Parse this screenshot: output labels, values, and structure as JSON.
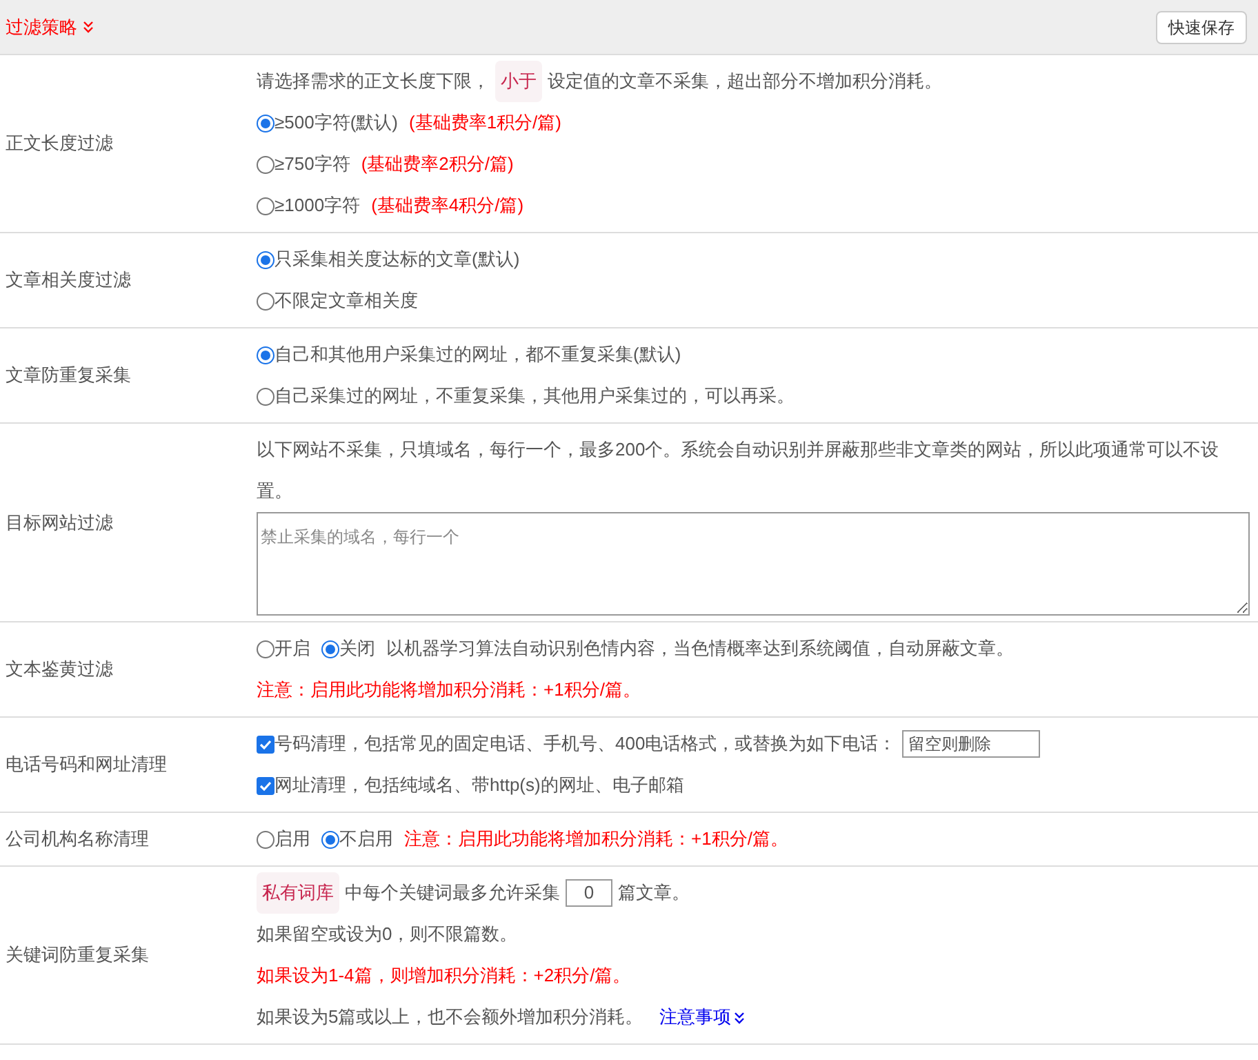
{
  "header": {
    "title": "过滤策略",
    "button": "快速保存"
  },
  "rows": [
    {
      "label": "正文长度过滤",
      "lines": [
        [
          {
            "kind": "text",
            "text": "请选择需求的正文长度下限，"
          },
          {
            "kind": "tag",
            "text": "小于"
          },
          {
            "kind": "text",
            "text": "设定值的文章不采集，超出部分不增加积分消耗。"
          }
        ],
        [
          {
            "kind": "radio",
            "text": "≥500字符(默认)",
            "selected": true
          },
          {
            "kind": "note",
            "text": "(基础费率1积分/篇)"
          }
        ],
        [
          {
            "kind": "radio",
            "text": "≥750字符",
            "selected": false
          },
          {
            "kind": "note",
            "text": "(基础费率2积分/篇)"
          }
        ],
        [
          {
            "kind": "radio",
            "text": "≥1000字符",
            "selected": false
          },
          {
            "kind": "note",
            "text": "(基础费率4积分/篇)"
          }
        ]
      ]
    },
    {
      "label": "文章相关度过滤",
      "lines": [
        [
          {
            "kind": "radio",
            "text": "只采集相关度达标的文章(默认)",
            "selected": true
          }
        ],
        [
          {
            "kind": "radio",
            "text": "不限定文章相关度",
            "selected": false
          }
        ]
      ]
    },
    {
      "label": "文章防重复采集",
      "lines": [
        [
          {
            "kind": "radio",
            "text": "自己和其他用户采集过的网址，都不重复采集(默认)",
            "selected": true
          }
        ],
        [
          {
            "kind": "radio",
            "text": "自己采集过的网址，不重复采集，其他用户采集过的，可以再采。",
            "selected": false
          }
        ]
      ]
    },
    {
      "label": "目标网站过滤",
      "lines": [
        [
          {
            "kind": "text",
            "text": "以下网站不采集，只填域名，每行一个，最多200个。系统会自动识别并屏蔽那些非文章类的网站，所以此项通常可以不设置。"
          }
        ],
        [
          {
            "kind": "textarea",
            "placeholder": "禁止采集的域名，每行一个"
          }
        ]
      ]
    },
    {
      "label": "文本鉴黄过滤",
      "lines": [
        [
          {
            "kind": "radio",
            "text": "开启",
            "selected": false
          },
          {
            "kind": "radio",
            "text": "关闭",
            "selected": true
          },
          {
            "kind": "text",
            "text": "以机器学习算法自动识别色情内容，当色情概率达到系统阈值，自动屏蔽文章。"
          }
        ],
        [
          {
            "kind": "note",
            "text": "注意：启用此功能将增加积分消耗：+1积分/篇。"
          }
        ]
      ]
    },
    {
      "label": "电话号码和网址清理",
      "lines": [
        [
          {
            "kind": "checkbox",
            "text": "号码清理，包括常见的固定电话、手机号、400电话格式，或替换为如下电话：",
            "checked": true
          },
          {
            "kind": "input",
            "placeholder": "留空则删除"
          }
        ],
        [
          {
            "kind": "checkbox",
            "text": "网址清理，包括纯域名、带http(s)的网址、电子邮箱",
            "checked": true
          }
        ]
      ]
    },
    {
      "label": "公司机构名称清理",
      "lines": [
        [
          {
            "kind": "radio",
            "text": "启用",
            "selected": false
          },
          {
            "kind": "radio",
            "text": "不启用",
            "selected": true
          },
          {
            "kind": "note",
            "text": "注意：启用此功能将增加积分消耗：+1积分/篇。"
          }
        ]
      ]
    },
    {
      "label": "关键词防重复采集",
      "lines": [
        [
          {
            "kind": "tag",
            "text": "私有词库"
          },
          {
            "kind": "text",
            "text": "中每个关键词最多允许采集"
          },
          {
            "kind": "input",
            "value": "0"
          },
          {
            "kind": "text",
            "text": "篇文章。"
          }
        ],
        [
          {
            "kind": "text",
            "text": "如果留空或设为0，则不限篇数。"
          }
        ],
        [
          {
            "kind": "note",
            "text": "如果设为1-4篇，则增加积分消耗：+2积分/篇。"
          }
        ],
        [
          {
            "kind": "text",
            "text": "如果设为5篇或以上，也不会额外增加积分消耗。"
          },
          {
            "kind": "link",
            "text": "注意事项"
          }
        ]
      ]
    }
  ]
}
